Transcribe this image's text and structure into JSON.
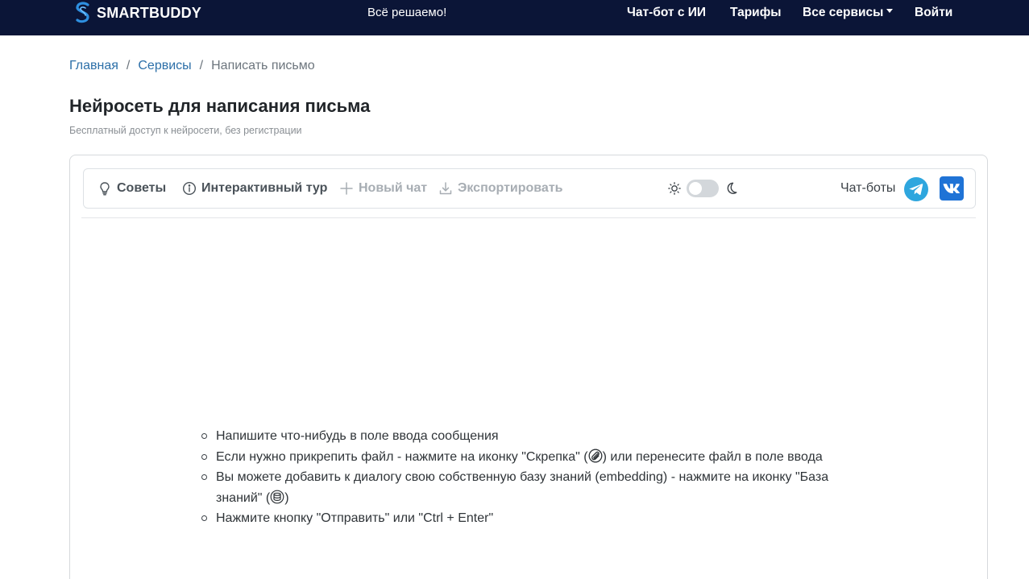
{
  "navbar": {
    "brand": "SMARTBUDDY",
    "tagline": "Всё решаемо!",
    "links": {
      "chatbot": "Чат-бот с ИИ",
      "pricing": "Тарифы",
      "services": "Все сервисы",
      "login": "Войти"
    }
  },
  "breadcrumb": {
    "home": "Главная",
    "sep": "/",
    "services": "Сервисы",
    "current": "Написать письмо"
  },
  "page": {
    "title": "Нейросеть для написания письма",
    "subtitle": "Бесплатный доступ к нейросети, без регистрации"
  },
  "toolbar": {
    "tips": "Советы",
    "tour": "Интерактивный тур",
    "new_chat": "Новый чат",
    "export": "Экспортировать",
    "bots_label": "Чат-боты",
    "theme_dark": false
  },
  "tips": {
    "item1": "Напишите что-нибудь в поле ввода сообщения",
    "item2_before": "Если нужно прикрепить файл - нажмите на иконку \"Скрепка\" (",
    "item2_after": ") или перенесите файл в поле ввода",
    "item3_before": "Вы можете добавить к диалогу свою собственную базу знаний (embedding) - нажмите на иконку \"База знаний\" (",
    "item3_after": ")",
    "item4": "Нажмите кнопку \"Отправить\" или \"Ctrl + Enter\""
  },
  "icons": {
    "brand": "smartbuddy-logo-icon",
    "tips": "lightbulb-icon",
    "tour": "info-circle-icon",
    "new_chat": "plus-icon",
    "export": "download-icon",
    "light": "sun-icon",
    "dark": "moon-icon",
    "telegram": "telegram-icon",
    "vk": "vk-icon",
    "attach": "paperclip-icon",
    "knowledge": "database-icon"
  },
  "colors": {
    "navbar_bg": "#0b1537",
    "link": "#2c6fa8",
    "telegram": "#2ea6de",
    "vk": "#1f73d6"
  }
}
